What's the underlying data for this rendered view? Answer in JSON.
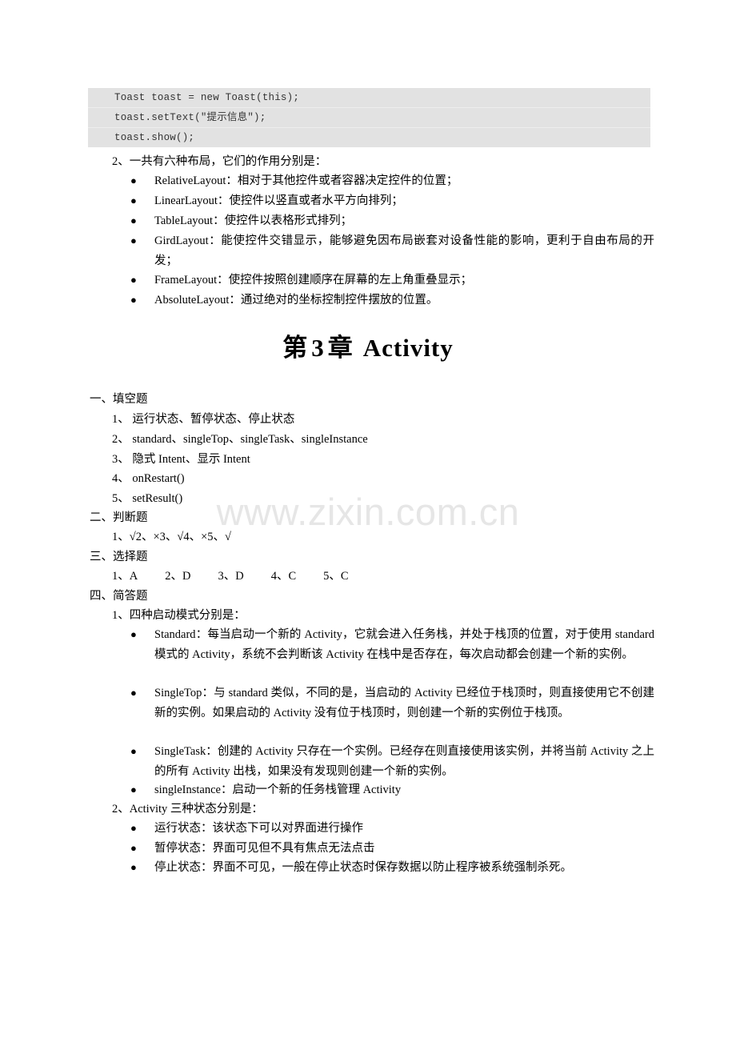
{
  "watermark": {
    "text": "www.zixin.com.cn",
    "color": "#e6e6e6"
  },
  "code_block": {
    "background": "#e2e2e2",
    "lines": [
      "Toast toast = new Toast(this);",
      "toast.setText(\"提示信息\");",
      "toast.show();"
    ]
  },
  "layout_question": {
    "number": "2、一共有六种布局，它们的作用分别是：",
    "bullet_char": "●",
    "items": [
      "RelativeLayout：相对于其他控件或者容器决定控件的位置；",
      "LinearLayout：使控件以竖直或者水平方向排列；",
      "TableLayout：使控件以表格形式排列；",
      "GirdLayout：能使控件交错显示，能够避免因布局嵌套对设备性能的影响，更利于自由布局的开发；",
      "FrameLayout：使控件按照创建顺序在屏幕的左上角重叠显示；",
      "AbsoluteLayout：通过绝对的坐标控制控件摆放的位置。"
    ]
  },
  "chapter": {
    "prefix": "第",
    "number": "3",
    "suffix": "章",
    "name": "Activity"
  },
  "section_fill": {
    "heading": "一、填空题",
    "items": [
      "1、 运行状态、暂停状态、停止状态",
      "2、 standard、singleTop、singleTask、singleInstance",
      "3、 隐式 Intent、显示 Intent",
      "4、 onRestart()",
      "5、 setResult()"
    ]
  },
  "section_truefalse": {
    "heading": "二、判断题",
    "answer": "1、√2、×3、√4、×5、√"
  },
  "section_choice": {
    "heading": "三、选择题",
    "answers": [
      "1、A",
      "2、D",
      "3、D",
      "4、C",
      "5、C"
    ]
  },
  "section_short": {
    "heading": "四、简答题",
    "bullet_char": "●",
    "q1": {
      "number": "1、四种启动模式分别是：",
      "items": [
        "Standard：每当启动一个新的 Activity，它就会进入任务栈，并处于栈顶的位置，对于使用 standard 模式的 Activity，系统不会判断该 Activity 在栈中是否存在，每次启动都会创建一个新的实例。",
        "SingleTop：与 standard 类似，不同的是，当启动的 Activity 已经位于栈顶时，则直接使用它不创建新的实例。如果启动的 Activity 没有位于栈顶时，则创建一个新的实例位于栈顶。",
        "SingleTask：创建的 Activity 只存在一个实例。已经存在则直接使用该实例，并将当前 Activity 之上的所有 Activity 出栈，如果没有发现则创建一个新的实例。",
        "singleInstance：启动一个新的任务栈管理 Activity"
      ]
    },
    "q2": {
      "number": "2、Activity 三种状态分别是：",
      "items": [
        "运行状态：该状态下可以对界面进行操作",
        "暂停状态：界面可见但不具有焦点无法点击",
        "停止状态：界面不可见，一般在停止状态时保存数据以防止程序被系统强制杀死。"
      ]
    }
  }
}
